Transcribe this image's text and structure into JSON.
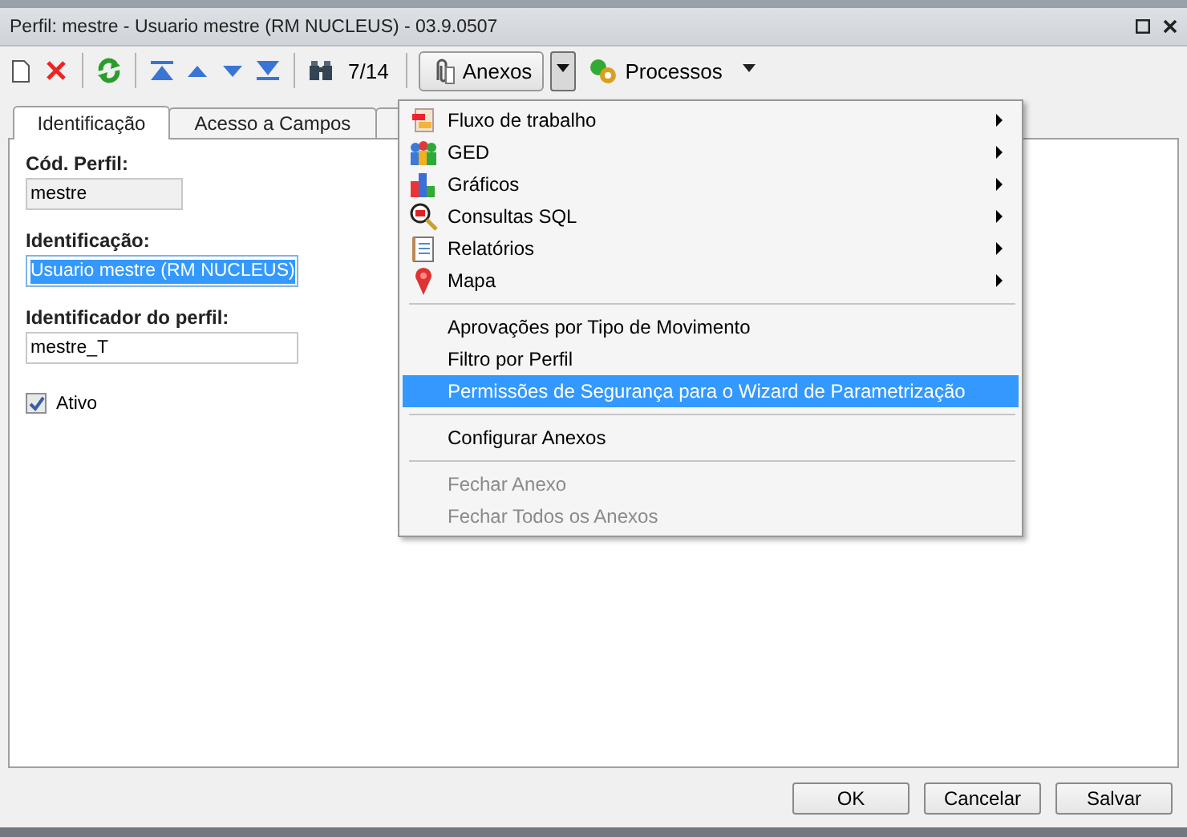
{
  "window": {
    "title": "Perfil: mestre - Usuario mestre (RM NUCLEUS) - 03.9.0507"
  },
  "toolbar": {
    "record_counter": "7/14",
    "attachments_button": "Anexos",
    "processes_button": "Processos"
  },
  "tabs": [
    {
      "label": "Identificação",
      "selected": true
    },
    {
      "label": "Acesso a Campos",
      "selected": false
    },
    {
      "selected": false
    }
  ],
  "form": {
    "fields": [
      {
        "label": "Cód. Perfil:",
        "value": "mestre",
        "disabled": true,
        "focused": false
      },
      {
        "label": "Identificação:",
        "value": "Usuario mestre (RM NUCLEUS)",
        "disabled": false,
        "focused": true
      },
      {
        "label": "Identificador do perfil:",
        "value": "mestre_T",
        "disabled": false,
        "focused": false
      }
    ],
    "checkbox": {
      "label": "Ativo",
      "checked": true
    }
  },
  "menu": {
    "items": [
      {
        "kind": "submenu",
        "label": "Fluxo de trabalho",
        "selected": false,
        "disabled": false
      },
      {
        "kind": "submenu",
        "label": "GED",
        "selected": false,
        "disabled": false
      },
      {
        "kind": "submenu",
        "label": "Gráficos",
        "selected": false,
        "disabled": false
      },
      {
        "kind": "submenu",
        "label": "Consultas SQL",
        "selected": false,
        "disabled": false
      },
      {
        "kind": "submenu",
        "label": "Relatórios",
        "selected": false,
        "disabled": false
      },
      {
        "kind": "submenu",
        "label": "Mapa",
        "selected": false,
        "disabled": false
      },
      {
        "kind": "separator"
      },
      {
        "kind": "item",
        "label": "Aprovações por Tipo de Movimento",
        "selected": false,
        "disabled": false
      },
      {
        "kind": "item",
        "label": "Filtro por Perfil",
        "selected": false,
        "disabled": false
      },
      {
        "kind": "item",
        "label": "Permissões de Segurança para o Wizard de Parametrização",
        "selected": true,
        "disabled": false
      },
      {
        "kind": "separator"
      },
      {
        "kind": "item",
        "label": "Configurar Anexos",
        "selected": false,
        "disabled": false
      },
      {
        "kind": "separator"
      },
      {
        "kind": "item",
        "label": "Fechar Anexo",
        "selected": false,
        "disabled": true
      },
      {
        "kind": "item",
        "label": "Fechar Todos os Anexos",
        "selected": false,
        "disabled": true
      }
    ]
  },
  "buttons": [
    "OK",
    "Cancelar",
    "Salvar"
  ]
}
